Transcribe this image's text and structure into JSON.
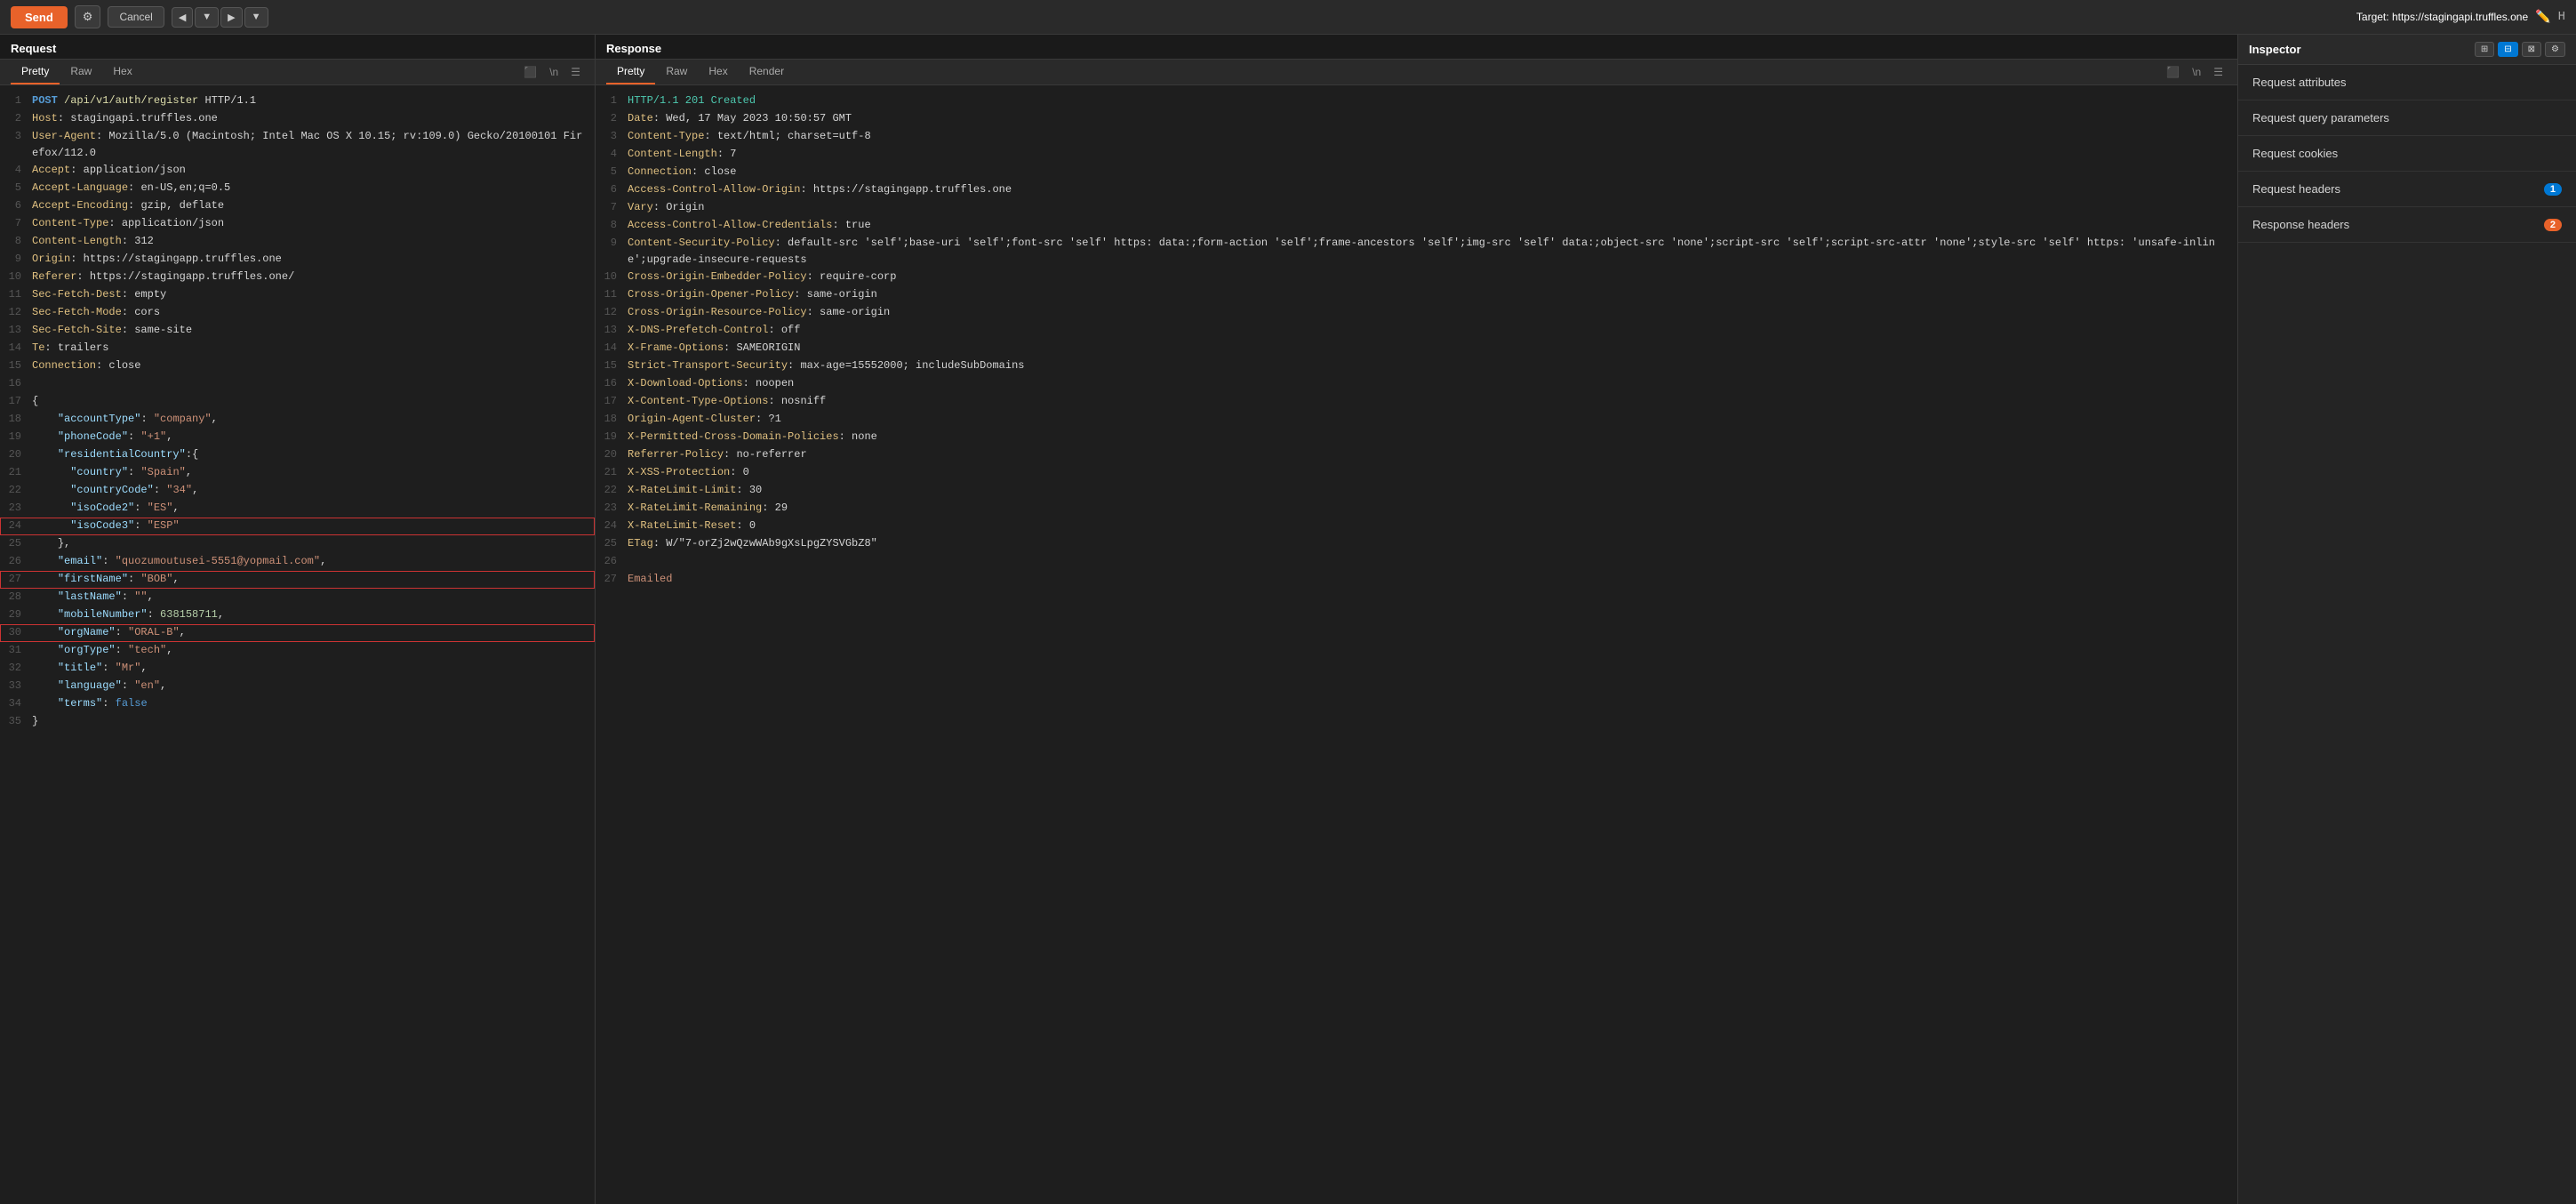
{
  "toolbar": {
    "send_label": "Send",
    "cancel_label": "Cancel",
    "target_prefix": "Target: ",
    "target_url": "https://stagingapi.truffles.one"
  },
  "request_pane": {
    "title": "Request",
    "tabs": [
      "Pretty",
      "Raw",
      "Hex"
    ],
    "active_tab": "Pretty"
  },
  "response_pane": {
    "title": "Response",
    "tabs": [
      "Pretty",
      "Raw",
      "Hex",
      "Render"
    ],
    "active_tab": "Pretty"
  },
  "inspector": {
    "title": "Inspector",
    "items": [
      {
        "label": "Request attributes",
        "badge": null
      },
      {
        "label": "Request query parameters",
        "badge": null
      },
      {
        "label": "Request cookies",
        "badge": null
      },
      {
        "label": "Request headers",
        "badge": "1"
      },
      {
        "label": "Response headers",
        "badge": "2"
      }
    ]
  },
  "request_lines": [
    {
      "num": 1,
      "content": "POST /api/v1/auth/register HTTP/1.1",
      "type": "http-start"
    },
    {
      "num": 2,
      "content": "Host: stagingapi.truffles.one",
      "type": "header"
    },
    {
      "num": 3,
      "content": "User-Agent: Mozilla/5.0 (Macintosh; Intel Mac OS X 10.15; rv:109.0) Gecko/20100101 Firefox/112.0",
      "type": "header"
    },
    {
      "num": 4,
      "content": "Accept: application/json",
      "type": "header"
    },
    {
      "num": 5,
      "content": "Accept-Language: en-US,en;q=0.5",
      "type": "header"
    },
    {
      "num": 6,
      "content": "Accept-Encoding: gzip, deflate",
      "type": "header"
    },
    {
      "num": 7,
      "content": "Content-Type: application/json",
      "type": "header"
    },
    {
      "num": 8,
      "content": "Content-Length: 312",
      "type": "header"
    },
    {
      "num": 9,
      "content": "Origin: https://stagingapp.truffles.one",
      "type": "header"
    },
    {
      "num": 10,
      "content": "Referer: https://stagingapp.truffles.one/",
      "type": "header"
    },
    {
      "num": 11,
      "content": "Sec-Fetch-Dest: empty",
      "type": "header"
    },
    {
      "num": 12,
      "content": "Sec-Fetch-Mode: cors",
      "type": "header"
    },
    {
      "num": 13,
      "content": "Sec-Fetch-Site: same-site",
      "type": "header"
    },
    {
      "num": 14,
      "content": "Te: trailers",
      "type": "header"
    },
    {
      "num": 15,
      "content": "Connection: close",
      "type": "header"
    },
    {
      "num": 16,
      "content": "",
      "type": "blank"
    },
    {
      "num": 17,
      "content": "{",
      "type": "json"
    },
    {
      "num": 18,
      "content": "    \"accountType\":\"company\",",
      "type": "json"
    },
    {
      "num": 19,
      "content": "    \"phoneCode\":\"+1\",",
      "type": "json"
    },
    {
      "num": 20,
      "content": "    \"residentialCountry\":{",
      "type": "json"
    },
    {
      "num": 21,
      "content": "      \"country\":\"Spain\",",
      "type": "json"
    },
    {
      "num": 22,
      "content": "      \"countryCode\":\"34\",",
      "type": "json"
    },
    {
      "num": 23,
      "content": "      \"isoCode2\":\"ES\",",
      "type": "json"
    },
    {
      "num": 24,
      "content": "      \"isoCode3\":\"ESP\"",
      "type": "json",
      "highlight": true
    },
    {
      "num": 25,
      "content": "    },",
      "type": "json"
    },
    {
      "num": 26,
      "content": "    \"email\":\"quozumoutusei-5551@yopmail.com\",",
      "type": "json"
    },
    {
      "num": 27,
      "content": "    \"firstName\":\"BOB\",",
      "type": "json",
      "highlight": true
    },
    {
      "num": 28,
      "content": "    \"lastName\":\"\",",
      "type": "json"
    },
    {
      "num": 29,
      "content": "    \"mobileNumber\":638158711,",
      "type": "json"
    },
    {
      "num": 30,
      "content": "    \"orgName\":\"ORAL-B\",",
      "type": "json",
      "highlight": true
    },
    {
      "num": 31,
      "content": "    \"orgType\":\"tech\",",
      "type": "json"
    },
    {
      "num": 32,
      "content": "    \"title\":\"Mr\",",
      "type": "json"
    },
    {
      "num": 33,
      "content": "    \"language\":\"en\",",
      "type": "json"
    },
    {
      "num": 34,
      "content": "    \"terms\":false",
      "type": "json"
    },
    {
      "num": 35,
      "content": "}",
      "type": "json"
    }
  ],
  "response_lines": [
    {
      "num": 1,
      "content": "HTTP/1.1 201 Created",
      "type": "status"
    },
    {
      "num": 2,
      "content": "Date: Wed, 17 May 2023 10:50:57 GMT",
      "type": "header"
    },
    {
      "num": 3,
      "content": "Content-Type: text/html; charset=utf-8",
      "type": "header"
    },
    {
      "num": 4,
      "content": "Content-Length: 7",
      "type": "header"
    },
    {
      "num": 5,
      "content": "Connection: close",
      "type": "header"
    },
    {
      "num": 6,
      "content": "Access-Control-Allow-Origin: https://stagingapp.truffles.one",
      "type": "header"
    },
    {
      "num": 7,
      "content": "Vary: Origin",
      "type": "header"
    },
    {
      "num": 8,
      "content": "Access-Control-Allow-Credentials: true",
      "type": "header"
    },
    {
      "num": 9,
      "content": "Content-Security-Policy: default-src 'self';base-uri 'self';font-src 'self' https: data:;form-action 'self';frame-ancestors 'self';img-src 'self' data:;object-src 'none';script-src 'self';script-src-attr 'none';style-src 'self' https: 'unsafe-inline';upgrade-insecure-requests",
      "type": "header"
    },
    {
      "num": 10,
      "content": "Cross-Origin-Embedder-Policy: require-corp",
      "type": "header"
    },
    {
      "num": 11,
      "content": "Cross-Origin-Opener-Policy: same-origin",
      "type": "header"
    },
    {
      "num": 12,
      "content": "Cross-Origin-Resource-Policy: same-origin",
      "type": "header"
    },
    {
      "num": 13,
      "content": "X-DNS-Prefetch-Control: off",
      "type": "header"
    },
    {
      "num": 14,
      "content": "X-Frame-Options: SAMEORIGIN",
      "type": "header"
    },
    {
      "num": 15,
      "content": "Strict-Transport-Security: max-age=15552000; includeSubDomains",
      "type": "header"
    },
    {
      "num": 16,
      "content": "X-Download-Options: noopen",
      "type": "header"
    },
    {
      "num": 17,
      "content": "X-Content-Type-Options: nosniff",
      "type": "header"
    },
    {
      "num": 18,
      "content": "Origin-Agent-Cluster: ?1",
      "type": "header"
    },
    {
      "num": 19,
      "content": "X-Permitted-Cross-Domain-Policies: none",
      "type": "header"
    },
    {
      "num": 20,
      "content": "Referrer-Policy: no-referrer",
      "type": "header"
    },
    {
      "num": 21,
      "content": "X-XSS-Protection: 0",
      "type": "header"
    },
    {
      "num": 22,
      "content": "X-RateLimit-Limit: 30",
      "type": "header"
    },
    {
      "num": 23,
      "content": "X-RateLimit-Remaining: 29",
      "type": "header"
    },
    {
      "num": 24,
      "content": "X-RateLimit-Reset: 0",
      "type": "header"
    },
    {
      "num": 25,
      "content": "ETag: W/\"7-orZj2wQzwWAb9gXsLpgZYSVGbZ8\"",
      "type": "header"
    },
    {
      "num": 26,
      "content": "",
      "type": "blank"
    },
    {
      "num": 27,
      "content": "Emailed",
      "type": "body"
    }
  ]
}
